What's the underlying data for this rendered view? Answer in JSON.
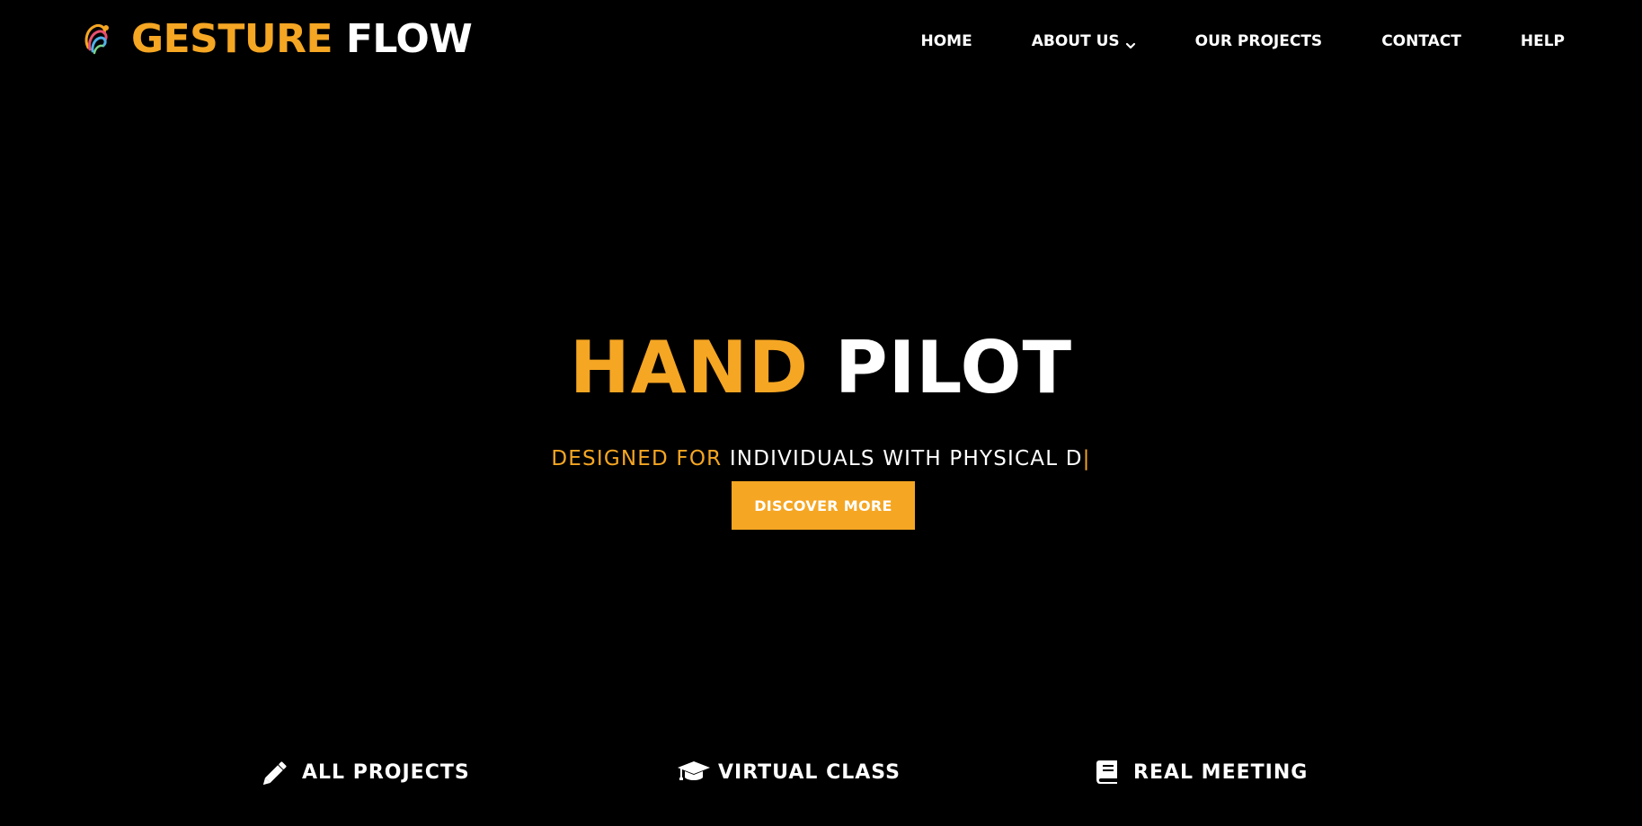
{
  "colors": {
    "background": "#000000",
    "accent": "#f5a623",
    "text": "#ffffff"
  },
  "brand": {
    "logo_icon": "hand-gesture-logo-icon",
    "name_accent": "GESTURE",
    "name_rest": "FLOW"
  },
  "nav": {
    "items": [
      {
        "label": "HOME"
      },
      {
        "label": "ABOUT US",
        "icon": "chevron-down-icon"
      },
      {
        "label": "OUR PROJECTS"
      },
      {
        "label": "CONTACT"
      },
      {
        "label": "HELP"
      }
    ]
  },
  "hero": {
    "title_accent": "HAND",
    "title_rest": "PILOT",
    "subtitle_accent": "DESIGNED FOR",
    "subtitle_rest": "INDIVIDUALS WITH PHYSICAL D",
    "typing_cursor": "|",
    "cta_label": "DISCOVER MORE"
  },
  "features": [
    {
      "icon": "pencil-icon",
      "label": "ALL PROJECTS"
    },
    {
      "icon": "graduation-cap-icon",
      "label": "VIRTUAL CLASS"
    },
    {
      "icon": "book-icon",
      "label": "REAL MEETING"
    }
  ]
}
